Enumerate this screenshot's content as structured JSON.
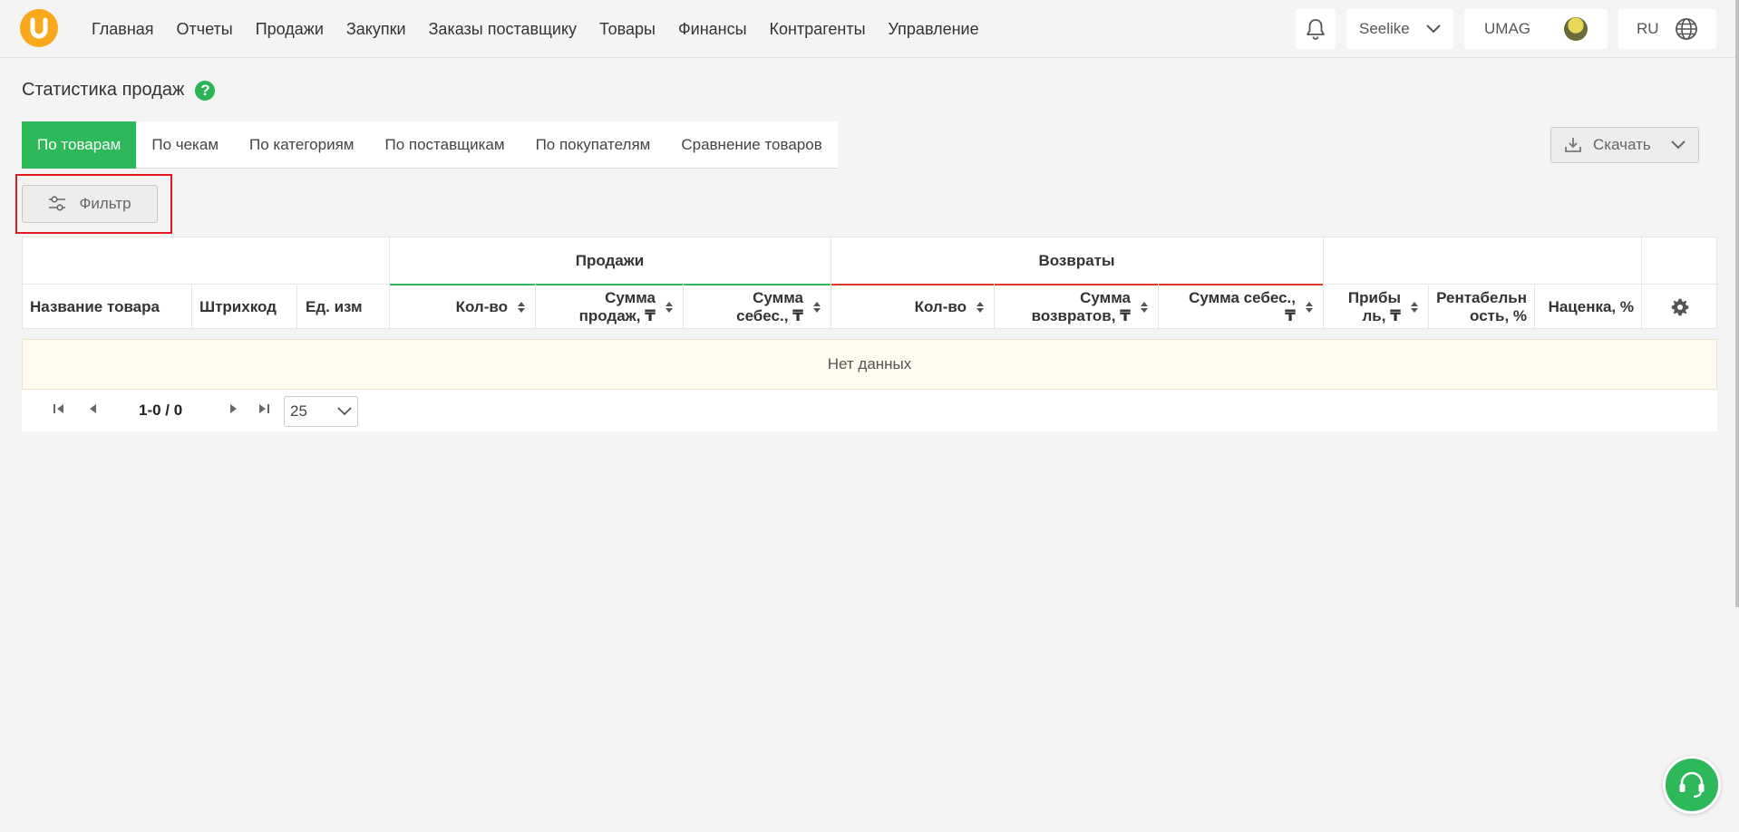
{
  "nav": {
    "items": [
      "Главная",
      "Отчеты",
      "Продажи",
      "Закупки",
      "Заказы поставщику",
      "Товары",
      "Финансы",
      "Контрагенты",
      "Управление"
    ],
    "company": "Seelike",
    "store": "UMAG",
    "language": "RU"
  },
  "page": {
    "title": "Статистика продаж"
  },
  "tabs": [
    "По товарам",
    "По чекам",
    "По категориям",
    "По поставщикам",
    "По покупателям",
    "Сравнение товаров"
  ],
  "toolbar": {
    "download_label": "Скачать",
    "filter_label": "Фильтр"
  },
  "table": {
    "groups": {
      "sales": "Продажи",
      "returns": "Возвраты"
    },
    "columns": {
      "name": "Название товара",
      "barcode": "Штрихкод",
      "unit": "Ед. изм",
      "sales_qty": "Кол-во",
      "sales_sum_1": "Сумма",
      "sales_sum_2": "продаж, ₸",
      "sales_cost_1": "Сумма",
      "sales_cost_2": "себес., ₸",
      "ret_qty": "Кол-во",
      "ret_sum_1": "Сумма",
      "ret_sum_2": "возвратов, ₸",
      "ret_cost_1": "Сумма себес.,",
      "ret_cost_2": "₸",
      "profit_1": "Прибы",
      "profit_2": "ль, ₸",
      "margin_1": "Рентабельн",
      "margin_2": "ость, %",
      "markup": "Наценка, %"
    },
    "empty_text": "Нет данных"
  },
  "pager": {
    "range": "1-0 / 0",
    "page_size": "25"
  },
  "colors": {
    "accent": "#2db85a",
    "logo": "#f7a81b",
    "returns_line": "#e0392b",
    "highlight": "#e0181f"
  }
}
